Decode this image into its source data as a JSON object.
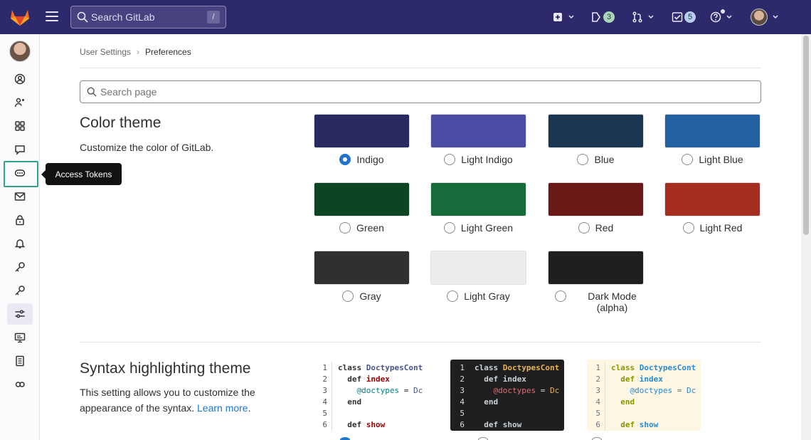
{
  "topbar": {
    "search_placeholder": "Search GitLab",
    "search_shortcut": "/",
    "mr_count": "3",
    "todo_count": "5",
    "icons": [
      "gitlab-logo",
      "menu-icon",
      "plus-icon",
      "issues-icon",
      "merge-request-icon",
      "todo-icon",
      "help-icon",
      "user-avatar"
    ]
  },
  "sidebar": {
    "items": [
      {
        "name": "profile",
        "icon": "user-icon"
      },
      {
        "name": "account",
        "icon": "account-icon"
      },
      {
        "name": "applications",
        "icon": "applications-icon"
      },
      {
        "name": "chat",
        "icon": "comment-icon"
      },
      {
        "name": "access-tokens",
        "icon": "token-icon"
      },
      {
        "name": "emails",
        "icon": "mail-icon"
      },
      {
        "name": "password",
        "icon": "lock-icon"
      },
      {
        "name": "notifications",
        "icon": "bell-icon"
      },
      {
        "name": "ssh-keys",
        "icon": "key-icon"
      },
      {
        "name": "gpg-keys",
        "icon": "key-icon"
      },
      {
        "name": "preferences",
        "icon": "preferences-icon"
      },
      {
        "name": "active-sessions",
        "icon": "monitor-icon"
      },
      {
        "name": "authentication-log",
        "icon": "log-icon"
      },
      {
        "name": "usage-quotas",
        "icon": "quota-icon"
      }
    ],
    "tooltip": "Access Tokens"
  },
  "breadcrumb": {
    "parent": "User Settings",
    "separator": "›",
    "current": "Preferences"
  },
  "page_search": {
    "placeholder": "Search page"
  },
  "color_theme": {
    "title": "Color theme",
    "description": "Customize the color of GitLab.",
    "themes": [
      {
        "label": "Indigo",
        "color": "#292961",
        "selected": true
      },
      {
        "label": "Light Indigo",
        "color": "#4b4ba3",
        "selected": false
      },
      {
        "label": "Blue",
        "color": "#1a3652",
        "selected": false
      },
      {
        "label": "Light Blue",
        "color": "#2261a1",
        "selected": false
      },
      {
        "label": "Green",
        "color": "#0d4524",
        "selected": false
      },
      {
        "label": "Light Green",
        "color": "#156b39",
        "selected": false
      },
      {
        "label": "Red",
        "color": "#691a16",
        "selected": false
      },
      {
        "label": "Light Red",
        "color": "#a62e21",
        "selected": false
      },
      {
        "label": "Gray",
        "color": "#303030",
        "selected": false
      },
      {
        "label": "Light Gray",
        "color": "#ececef",
        "selected": false
      },
      {
        "label": "Dark Mode",
        "label2": "(alpha)",
        "color": "#1f1f1f",
        "selected": false
      }
    ]
  },
  "syntax_theme": {
    "title": "Syntax highlighting theme",
    "description_1": "This setting allows you to customize the",
    "description_2": "appearance of the syntax. ",
    "link": "Learn more",
    "suffix": ".",
    "line_numbers": [
      "1",
      "2",
      "3",
      "4",
      "5",
      "6"
    ],
    "code_lines": [
      "class DoctypesCont",
      "  def index",
      "    @doctypes = Dc",
      "  end",
      "",
      "  def show"
    ]
  }
}
